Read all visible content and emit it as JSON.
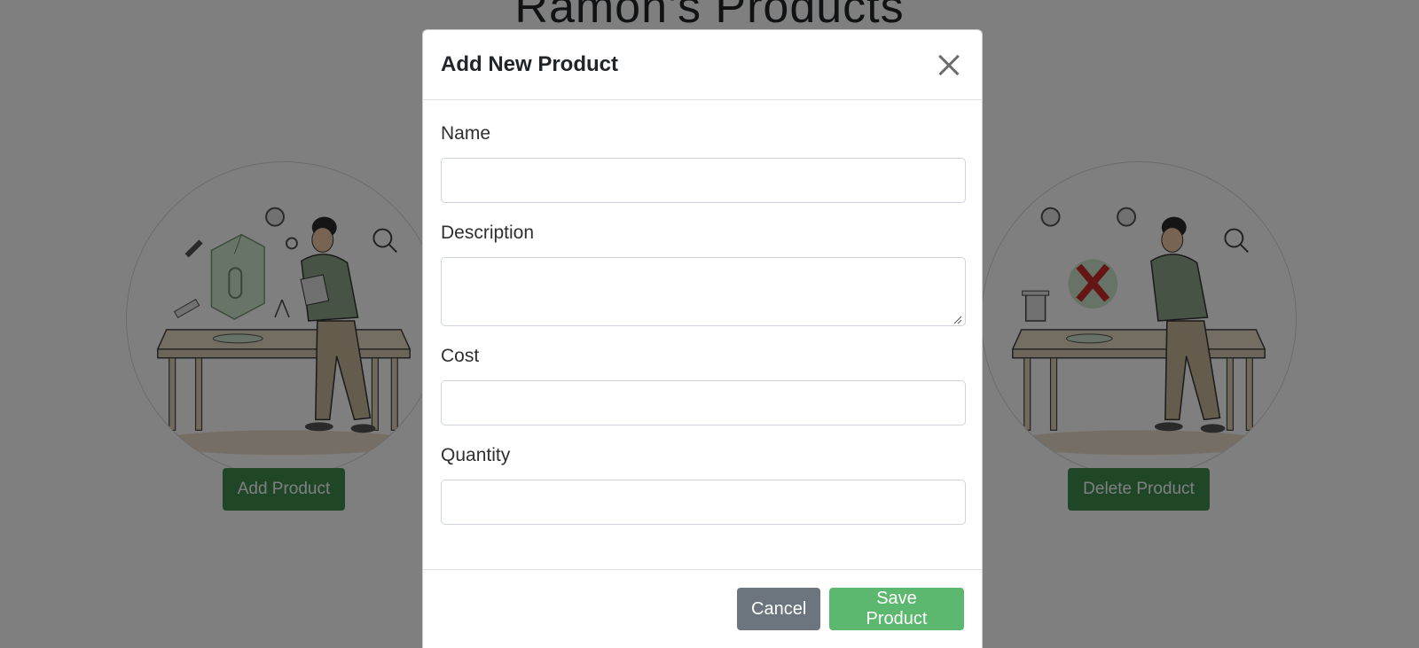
{
  "page": {
    "title": "Ramon's Products"
  },
  "cards": {
    "add_button": "Add Product",
    "delete_button": "Delete Product"
  },
  "modal": {
    "title": "Add New Product",
    "close_icon": "close-icon",
    "fields": {
      "name_label": "Name",
      "name_value": "",
      "description_label": "Description",
      "description_value": "",
      "cost_label": "Cost",
      "cost_value": "",
      "quantity_label": "Quantity",
      "quantity_value": ""
    },
    "footer": {
      "cancel_label": "Cancel",
      "save_label": "Save Product"
    }
  },
  "colors": {
    "primary_green": "#3f8f4f",
    "save_green": "#5cb86e",
    "cancel_gray": "#6c757d",
    "backdrop": "rgba(0,0,0,0.5)"
  }
}
